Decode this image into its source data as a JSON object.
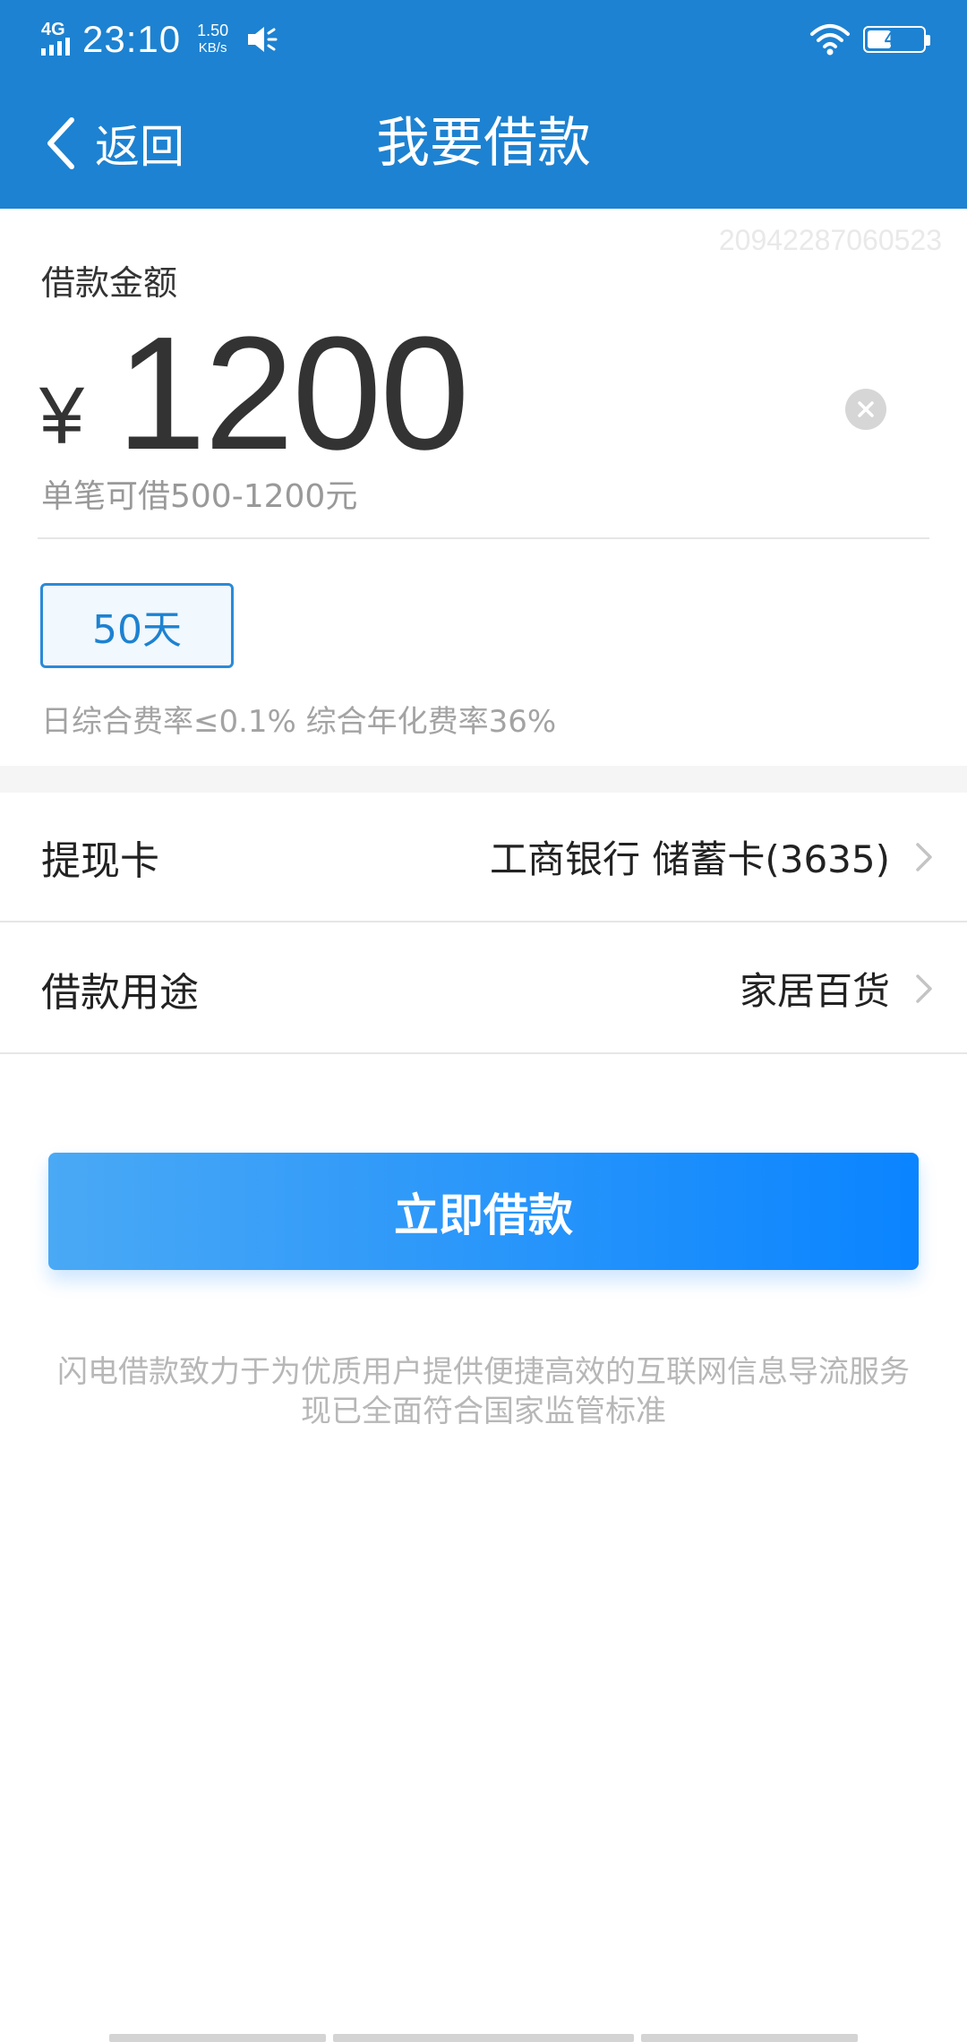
{
  "status_bar": {
    "network": "4G",
    "time": "23:10",
    "speed_value": "1.50",
    "speed_unit": "KB/s",
    "battery_level": "44",
    "battery_fraction": 0.44
  },
  "nav": {
    "back_label": "返回",
    "title": "我要借款"
  },
  "loan": {
    "order_id": "20942287060523",
    "amount_label": "借款金额",
    "currency": "¥",
    "amount": "1200",
    "range_hint": "单笔可借500-1200元",
    "term": "50天",
    "rate_note": "日综合费率≤0.1% 综合年化费率36%"
  },
  "rows": {
    "card_label": "提现卡",
    "card_value": "工商银行 储蓄卡(3635)",
    "purpose_label": "借款用途",
    "purpose_value": "家居百货"
  },
  "submit_label": "立即借款",
  "disclaimer": {
    "line1": "闪电借款致力于为优质用户提供便捷高效的互联网信息导流服务",
    "line2": "现已全面符合国家监管标准"
  },
  "icons": {
    "back": "chevron-left-icon",
    "clear": "close-circle-icon",
    "row_arrow": "chevron-right-icon",
    "wifi": "wifi-icon",
    "speaker": "speaker-icon"
  },
  "colors": {
    "primary": "#1d82d1",
    "button_start": "#4aa9f5",
    "button_end": "#0a84ff"
  }
}
